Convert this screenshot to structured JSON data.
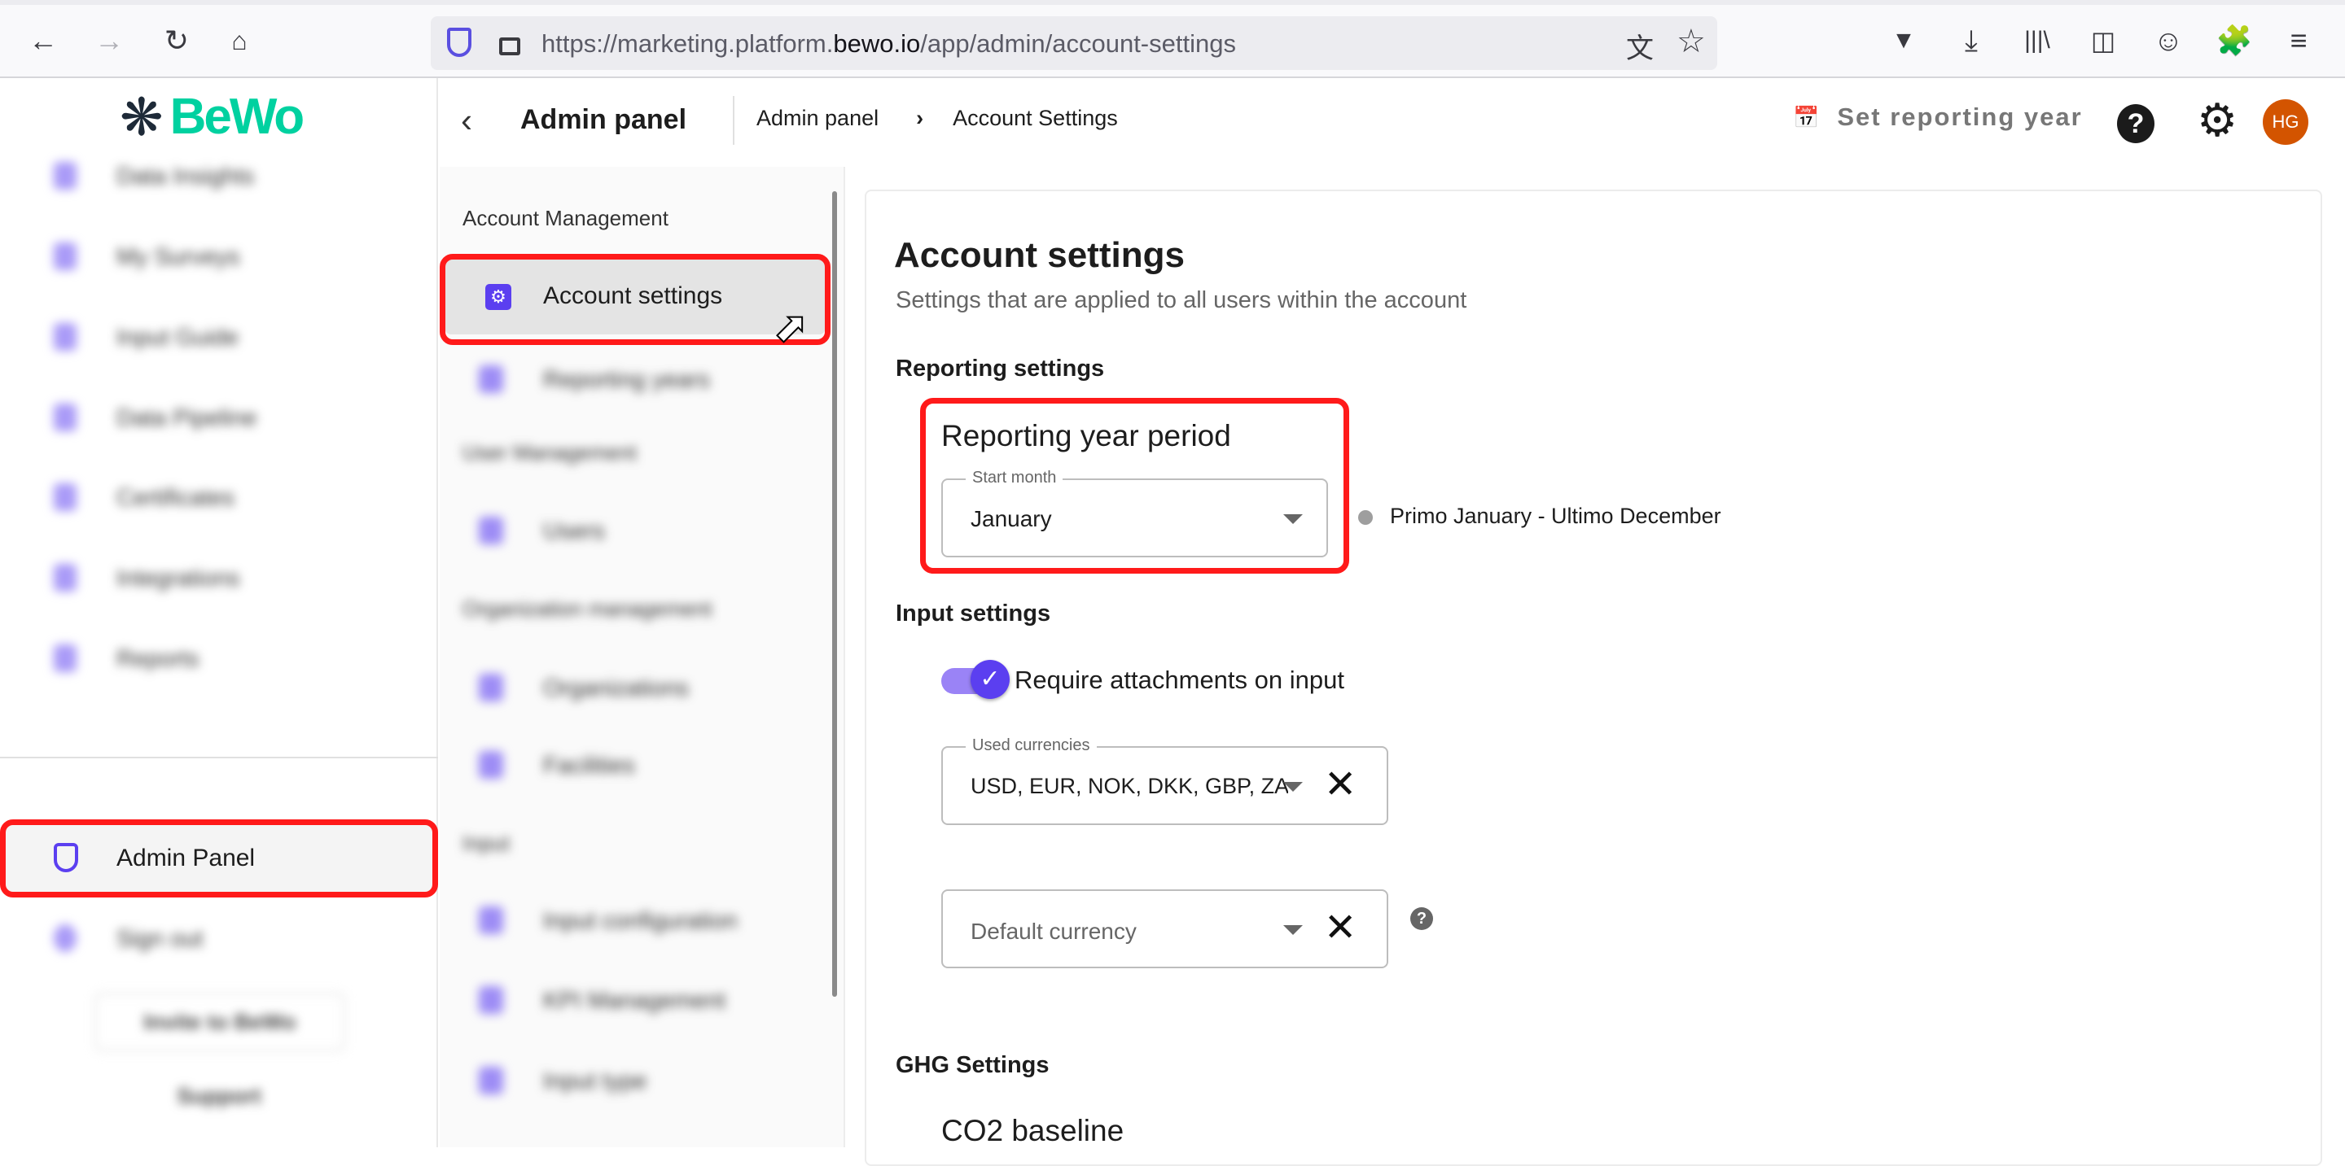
{
  "browser": {
    "url_prefix": "https://marketing.platform.",
    "url_domain": "bewo.io",
    "url_path": "/app/admin/account-settings",
    "icons": [
      "back-icon",
      "forward-icon",
      "reload-icon",
      "home-icon",
      "shield-icon",
      "lock-icon",
      "translate-icon",
      "star-icon",
      "pocket-icon",
      "download-icon",
      "library-icon",
      "sidebar-icon",
      "account-icon",
      "extensions-icon",
      "menu-icon"
    ]
  },
  "brand": {
    "name": "BeWo",
    "color": "#00d1a0"
  },
  "sidebar": {
    "items": [
      {
        "label": "Data Insights"
      },
      {
        "label": "My Surveys"
      },
      {
        "label": "Input Guide"
      },
      {
        "label": "Data Pipeline"
      },
      {
        "label": "Certificates"
      },
      {
        "label": "Integrations"
      },
      {
        "label": "Reports"
      }
    ],
    "admin_panel": "Admin Panel",
    "sign_out": "Sign out",
    "invite": "Invite to BeWo",
    "support": "Support"
  },
  "header": {
    "title": "Admin panel",
    "breadcrumb": [
      "Admin panel",
      "Account Settings"
    ],
    "set_reporting_year": "Set reporting year",
    "avatar": "HG",
    "avatar_color": "#d35400"
  },
  "panel": {
    "groups": [
      {
        "heading": "Account Management",
        "items": [
          "Account settings",
          "Reporting years"
        ]
      },
      {
        "heading": "User Management",
        "items": [
          "Users"
        ]
      },
      {
        "heading": "Organization management",
        "items": [
          "Organizations",
          "Facilities"
        ]
      },
      {
        "heading": "Input",
        "items": [
          "Input configuration",
          "KPI Management",
          "Input type"
        ]
      }
    ],
    "active": "Account settings"
  },
  "main": {
    "title": "Account settings",
    "subtitle": "Settings that are applied to all users within the account",
    "reporting_settings": "Reporting settings",
    "reporting_year_period": "Reporting year period",
    "start_month_label": "Start month",
    "start_month_value": "January",
    "period_text": "Primo January - Ultimo December",
    "input_settings": "Input settings",
    "require_attachments": "Require attachments on input",
    "require_attachments_on": true,
    "used_currencies_label": "Used currencies",
    "used_currencies_value": "USD, EUR, NOK, DKK, GBP, ZAR",
    "default_currency_placeholder": "Default currency",
    "ghg_settings": "GHG Settings",
    "co2_baseline": "CO2 baseline"
  },
  "accent": "#5b3ff0",
  "highlight": "#ff1a1a"
}
